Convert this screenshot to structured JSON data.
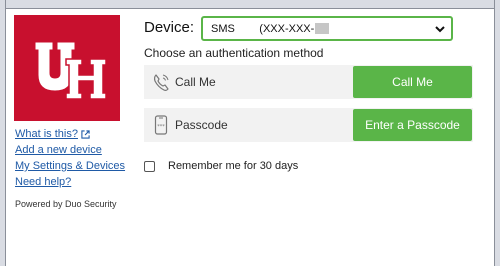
{
  "logo": {
    "alt_text": "UH"
  },
  "side_links": [
    {
      "label": "What is this?",
      "external": true
    },
    {
      "label": "Add a new device"
    },
    {
      "label": "My Settings & Devices"
    },
    {
      "label": "Need help?"
    }
  ],
  "powered_by": "Powered by Duo Security",
  "device": {
    "label": "Device:",
    "selected_type": "SMS",
    "selected_number": "(XXX-XXX-",
    "border_color": "#5ab548"
  },
  "choose_method": "Choose an authentication method",
  "methods": [
    {
      "icon": "phone-icon",
      "label": "Call Me",
      "button": "Call Me"
    },
    {
      "icon": "mobile-device-icon",
      "label": "Passcode",
      "button": "Enter a Passcode"
    }
  ],
  "remember": {
    "label": "Remember me for 30 days",
    "checked": false
  },
  "colors": {
    "brand_red": "#c8102e",
    "button_green": "#5ab548",
    "link_blue": "#1f5aa6",
    "row_bg": "#f2f2f2"
  }
}
